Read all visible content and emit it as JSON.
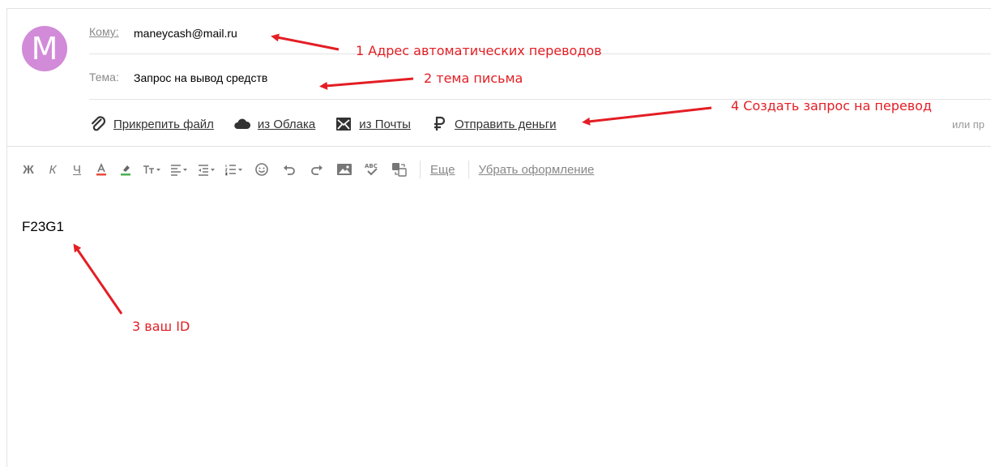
{
  "compose": {
    "avatar_letter": "M",
    "to_label": "Кому:",
    "to_value": "maneycash@mail.ru",
    "subject_label": "Тема:",
    "subject_value": "Запрос на вывод средств",
    "attachments": [
      {
        "label": "Прикрепить файл",
        "icon": "paperclip-icon"
      },
      {
        "label": "из Облака",
        "icon": "cloud-icon"
      },
      {
        "label": "из Почты",
        "icon": "mail-icon"
      },
      {
        "label": "Отправить деньги",
        "icon": "ruble-icon"
      }
    ],
    "or_text": "или пр",
    "body_text": "F23G1"
  },
  "toolbar": {
    "bold": "Ж",
    "italic": "К",
    "underline": "Ч",
    "more_label": "Еще",
    "clear_label": "Убрать оформление"
  },
  "annotations": {
    "a1": "1 Адрес автоматических переводов",
    "a2": "2 тема письма",
    "a3": "3 ваш ID",
    "a4": "4 Создать запрос на перевод"
  },
  "colors": {
    "avatar": "#d28bd8",
    "annotation": "#e31e24"
  }
}
